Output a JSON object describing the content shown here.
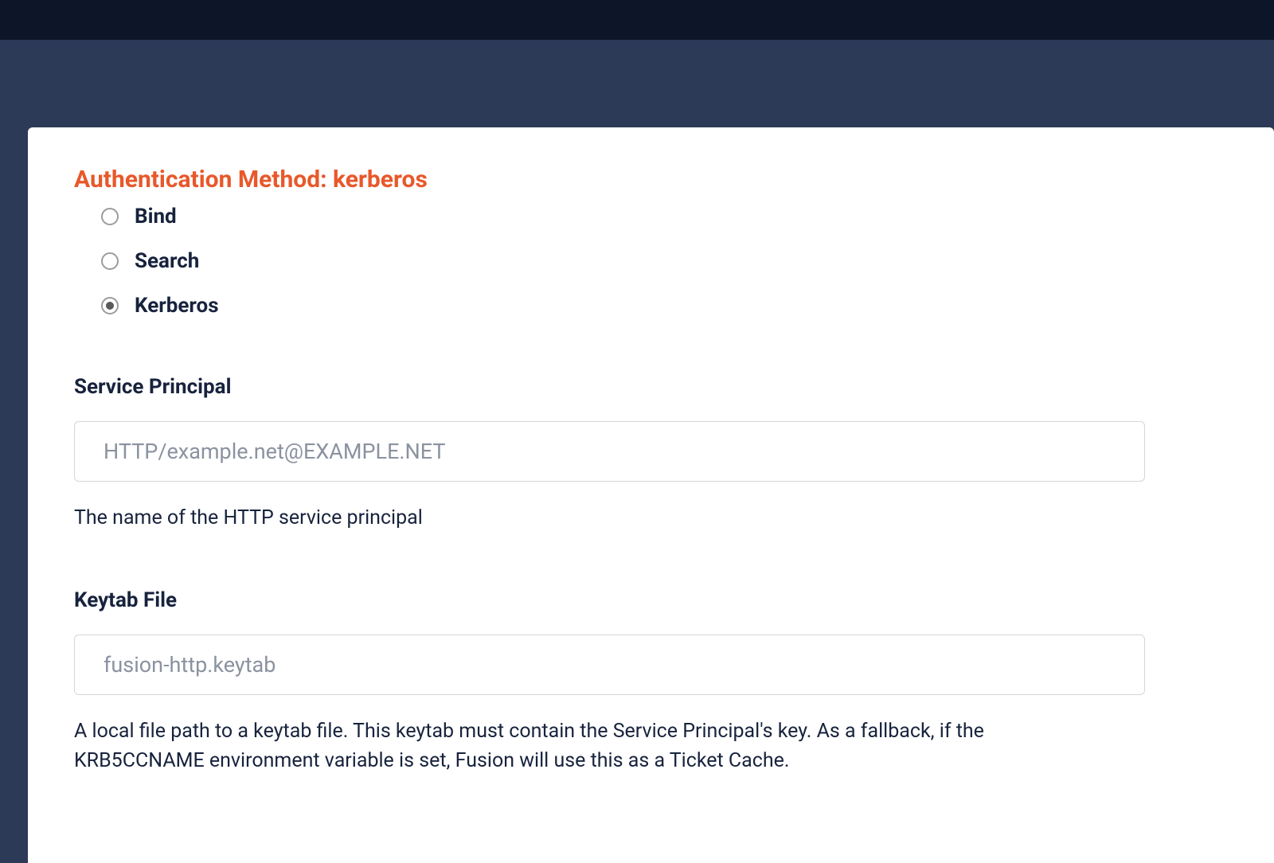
{
  "section": {
    "title": "Authentication Method: kerberos"
  },
  "radios": {
    "bind": "Bind",
    "search": "Search",
    "kerberos": "Kerberos",
    "selected": "kerberos"
  },
  "fields": {
    "service_principal": {
      "label": "Service Principal",
      "placeholder": "HTTP/example.net@EXAMPLE.NET",
      "value": "",
      "help": "The name of the HTTP service principal"
    },
    "keytab_file": {
      "label": "Keytab File",
      "placeholder": "fusion-http.keytab",
      "value": "",
      "help": "A local file path to a keytab file. This keytab must contain the Service Principal's key. As a fallback, if the KRB5CCNAME environment variable is set, Fusion will use this as a Ticket Cache."
    }
  }
}
